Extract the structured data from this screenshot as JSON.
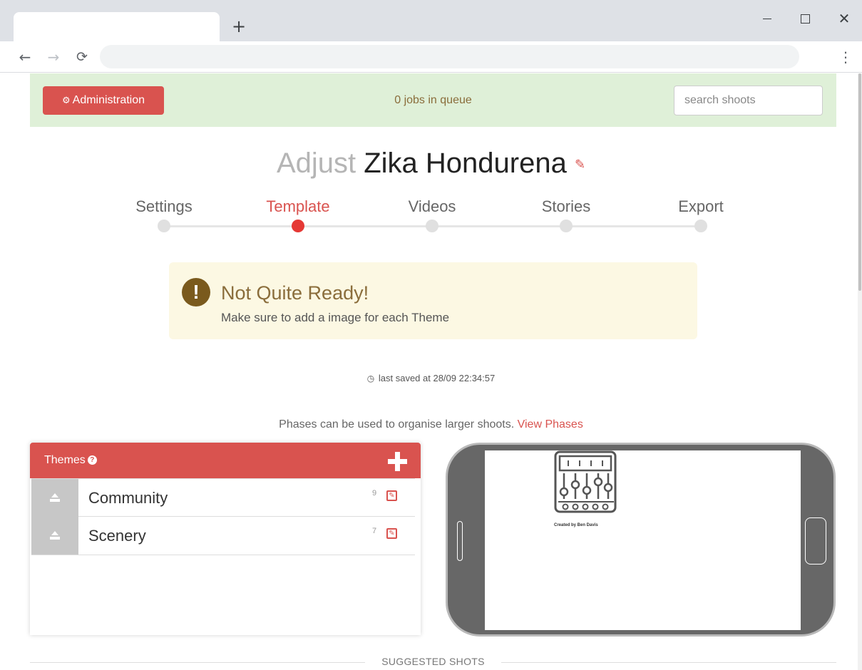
{
  "browser": {
    "new_tab_symbol": "+",
    "back_symbol": "←",
    "forward_symbol": "→",
    "reload_symbol": "C",
    "menu_symbol": "⋮",
    "close_symbol": "✕"
  },
  "topbar": {
    "admin_label": "Administration",
    "admin_icon": "gears-icon",
    "queue_text": "0 jobs in queue",
    "search_placeholder": "search shoots",
    "background_color": "#dff0d8",
    "accent_color": "#d9534f"
  },
  "title": {
    "prefix": "Adjust",
    "name": "Zika Hondurena",
    "edit_icon": "pencil-icon"
  },
  "steps": [
    {
      "label": "Settings",
      "active": false
    },
    {
      "label": "Template",
      "active": true
    },
    {
      "label": "Videos",
      "active": false
    },
    {
      "label": "Stories",
      "active": false
    },
    {
      "label": "Export",
      "active": false
    }
  ],
  "alert": {
    "icon": "exclamation-icon",
    "title": "Not Quite Ready!",
    "message": "Make sure to add a image for each Theme"
  },
  "saved": {
    "text": "last saved at 28/09 22:34:57",
    "icon": "clock-icon"
  },
  "phases": {
    "text": "Phases can be used to organise larger shoots.",
    "link": "View Phases"
  },
  "themes": {
    "title": "Themes",
    "help_icon_glyph": "?",
    "items": [
      {
        "name": "Community",
        "count": "9"
      },
      {
        "name": "Scenery",
        "count": "7"
      }
    ]
  },
  "phone_preview": {
    "credit": "Created by Ben Davis",
    "screen_icon": "mixer-sliders-icon"
  },
  "suggested_shots": {
    "label": "SUGGESTED SHOTS"
  }
}
